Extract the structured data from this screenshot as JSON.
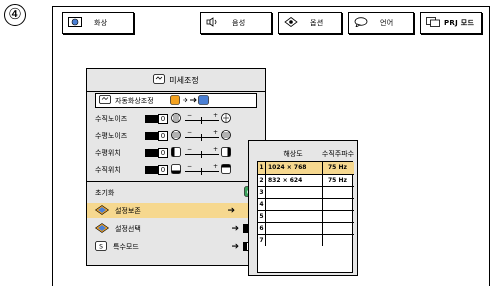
{
  "step": "④",
  "tabs": [
    {
      "label": "화상",
      "icon": "picture-icon"
    },
    {
      "label": "음성",
      "icon": "speaker-icon"
    },
    {
      "label": "옵션",
      "icon": "options-icon"
    },
    {
      "label": "언어",
      "icon": "language-icon"
    },
    {
      "label": "PRJ 모드",
      "icon": "prj-mode-icon"
    }
  ],
  "menu": {
    "title": "미세조정",
    "auto_sync": "자동화상조정",
    "rows": [
      {
        "label": "수직노이즈",
        "value": "0"
      },
      {
        "label": "수평노이즈",
        "value": "0"
      },
      {
        "label": "수평위치",
        "value": "0"
      },
      {
        "label": "수직위치",
        "value": "0"
      }
    ],
    "reset": "초기화",
    "save": "설정보존",
    "select": "설정선택",
    "special": "특수모드"
  },
  "table": {
    "col_resolution": "해상도",
    "col_freq": "수직주파수",
    "rows": [
      {
        "num": "1",
        "res": "1024 × 768",
        "freq": "75 Hz"
      },
      {
        "num": "2",
        "res": "832 × 624",
        "freq": "75 Hz"
      },
      {
        "num": "3",
        "res": "",
        "freq": ""
      },
      {
        "num": "4",
        "res": "",
        "freq": ""
      },
      {
        "num": "5",
        "res": "",
        "freq": ""
      },
      {
        "num": "6",
        "res": "",
        "freq": ""
      },
      {
        "num": "7",
        "res": "",
        "freq": ""
      }
    ]
  }
}
